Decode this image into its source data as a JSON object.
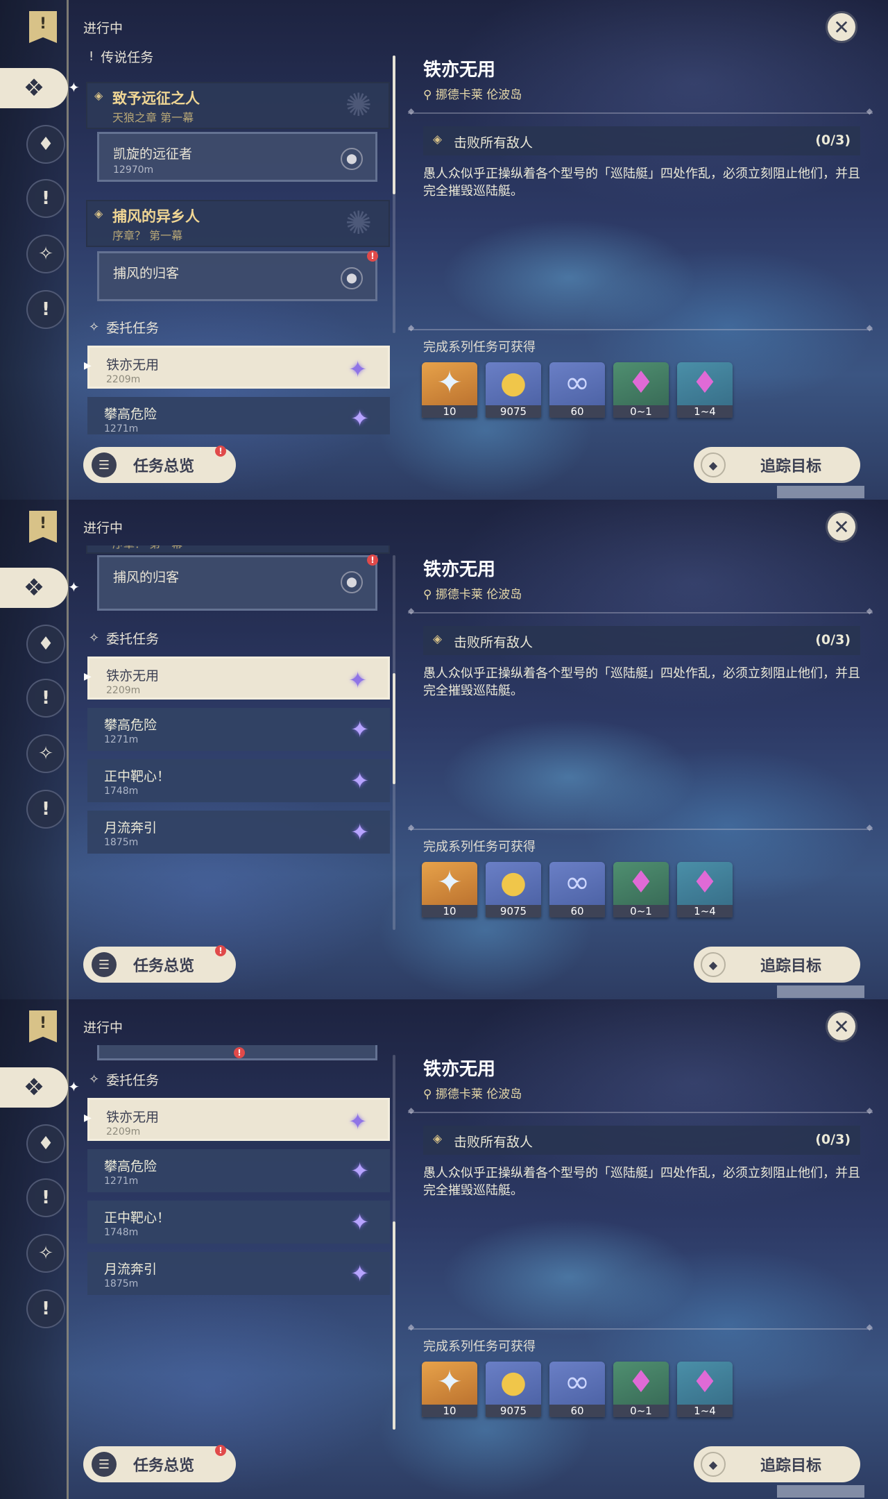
{
  "panels": [
    {
      "status_label": "进行中",
      "sections": {
        "legend": "传说任务",
        "commission": "委托任务"
      },
      "legend_chapters": [
        {
          "title": "致予远征之人",
          "subtitle": "天狼之章 第一幕",
          "subquest": {
            "title": "凯旋的远征者",
            "distance": "12970m"
          }
        },
        {
          "title": "捕风的异乡人",
          "subtitle": "序章？ 第一幕",
          "subquest": {
            "title": "捕风的归客",
            "distance": ""
          }
        }
      ],
      "commissions": [
        {
          "title": "铁亦无用",
          "distance": "2209m"
        },
        {
          "title": "攀高危险",
          "distance": "1271m"
        }
      ]
    },
    {
      "status_label": "进行中",
      "partial_subtitle": "序章？ 第一幕",
      "partial_subquest": "捕风的归客",
      "sections": {
        "commission": "委托任务"
      },
      "commissions": [
        {
          "title": "铁亦无用",
          "distance": "2209m"
        },
        {
          "title": "攀高危险",
          "distance": "1271m"
        },
        {
          "title": "正中靶心！",
          "distance": "1748m"
        },
        {
          "title": "月流奔引",
          "distance": "1875m"
        }
      ]
    },
    {
      "status_label": "进行中",
      "sections": {
        "commission": "委托任务"
      },
      "commissions": [
        {
          "title": "铁亦无用",
          "distance": "2209m"
        },
        {
          "title": "攀高危险",
          "distance": "1271m"
        },
        {
          "title": "正中靶心！",
          "distance": "1748m"
        },
        {
          "title": "月流奔引",
          "distance": "1875m"
        }
      ]
    }
  ],
  "detail": {
    "title": "铁亦无用",
    "location": "挪德卡莱 伦波岛",
    "objective": "击败所有敌人",
    "progress": "(0/3)",
    "description": "愚人众似乎正操纵着各个型号的「巡陆艇」四处作乱，必须立刻阻止他们，并且完全摧毁巡陆艇。",
    "rewards_label": "完成系列任务可获得",
    "rewards": [
      {
        "icon": "primogem-icon",
        "qty": "10"
      },
      {
        "icon": "mora-icon",
        "qty": "9075"
      },
      {
        "icon": "companionship-exp-icon",
        "qty": "60"
      },
      {
        "icon": "crystal-chunk-icon",
        "qty": "0~1"
      },
      {
        "icon": "crystal-ore-icon",
        "qty": "1~4"
      }
    ]
  },
  "buttons": {
    "overview": "任务总览",
    "track": "追踪目标"
  },
  "colors": {
    "accent_cream": "#ece5d3",
    "legend_gold": "#f0d694",
    "badge_red": "#e04a4a",
    "commission_star": "#b7a4ff"
  }
}
